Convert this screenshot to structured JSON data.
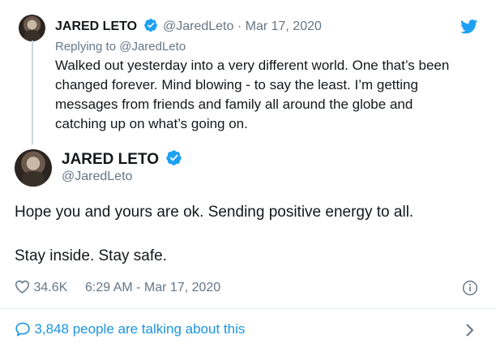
{
  "reply": {
    "name": "JARED LETO",
    "handle": "@JaredLeto",
    "separator": "·",
    "date": "Mar 17, 2020",
    "replying_to": "Replying to @JaredLeto",
    "text": "Walked out yesterday into a very different world. One that’s been changed forever. Mind blowing - to say the least. I’m getting messages from friends and family all around the globe and catching up on what’s going on.",
    "lines": [
      "Walked out yesterday into a very different world. One that’s been",
      "changed forever. Mind blowing - to say the least. I’m getting",
      "messages from friends and family all around the globe and",
      "catching up on what’s going on."
    ]
  },
  "main": {
    "name": "JARED LETO",
    "handle": "@JaredLeto",
    "text_line1": "Hope you and yours are ok. Sending positive energy to all.",
    "text_line2": "Stay inside. Stay safe.",
    "likes": "34.6K",
    "timestamp": "6:29 AM - Mar 17, 2020"
  },
  "footer": {
    "talking": "3,848 people are talking about this"
  },
  "colors": {
    "twitter_blue": "#1da1f2",
    "link_blue": "#1b95e0",
    "muted": "#657786"
  },
  "icons": [
    "twitter-bird-icon",
    "verified-badge-icon",
    "heart-icon",
    "info-icon",
    "comment-bubble-icon",
    "chevron-right-icon"
  ]
}
